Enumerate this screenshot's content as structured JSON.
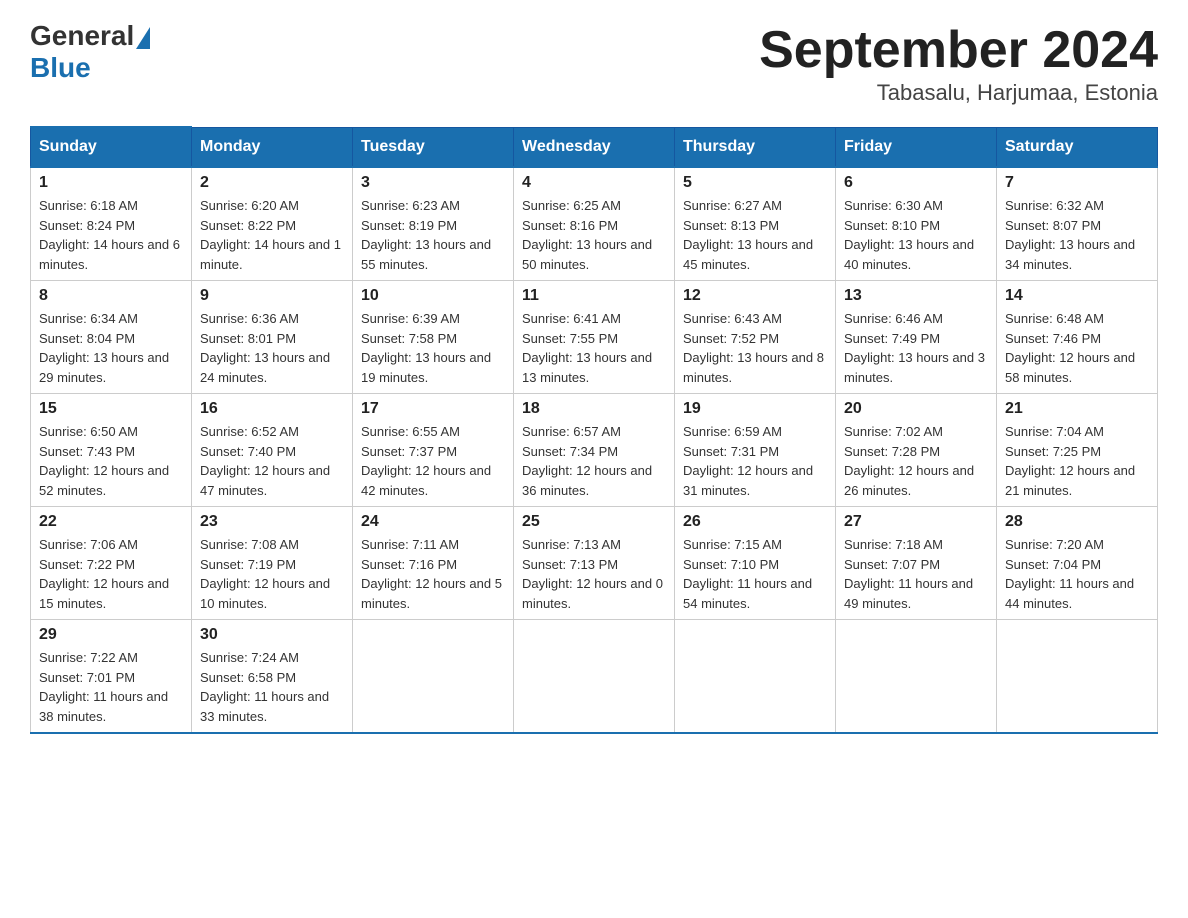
{
  "logo": {
    "general": "General",
    "blue": "Blue"
  },
  "title": "September 2024",
  "location": "Tabasalu, Harjumaa, Estonia",
  "headers": [
    "Sunday",
    "Monday",
    "Tuesday",
    "Wednesday",
    "Thursday",
    "Friday",
    "Saturday"
  ],
  "weeks": [
    [
      {
        "day": "1",
        "sunrise": "6:18 AM",
        "sunset": "8:24 PM",
        "daylight": "14 hours and 6 minutes."
      },
      {
        "day": "2",
        "sunrise": "6:20 AM",
        "sunset": "8:22 PM",
        "daylight": "14 hours and 1 minute."
      },
      {
        "day": "3",
        "sunrise": "6:23 AM",
        "sunset": "8:19 PM",
        "daylight": "13 hours and 55 minutes."
      },
      {
        "day": "4",
        "sunrise": "6:25 AM",
        "sunset": "8:16 PM",
        "daylight": "13 hours and 50 minutes."
      },
      {
        "day": "5",
        "sunrise": "6:27 AM",
        "sunset": "8:13 PM",
        "daylight": "13 hours and 45 minutes."
      },
      {
        "day": "6",
        "sunrise": "6:30 AM",
        "sunset": "8:10 PM",
        "daylight": "13 hours and 40 minutes."
      },
      {
        "day": "7",
        "sunrise": "6:32 AM",
        "sunset": "8:07 PM",
        "daylight": "13 hours and 34 minutes."
      }
    ],
    [
      {
        "day": "8",
        "sunrise": "6:34 AM",
        "sunset": "8:04 PM",
        "daylight": "13 hours and 29 minutes."
      },
      {
        "day": "9",
        "sunrise": "6:36 AM",
        "sunset": "8:01 PM",
        "daylight": "13 hours and 24 minutes."
      },
      {
        "day": "10",
        "sunrise": "6:39 AM",
        "sunset": "7:58 PM",
        "daylight": "13 hours and 19 minutes."
      },
      {
        "day": "11",
        "sunrise": "6:41 AM",
        "sunset": "7:55 PM",
        "daylight": "13 hours and 13 minutes."
      },
      {
        "day": "12",
        "sunrise": "6:43 AM",
        "sunset": "7:52 PM",
        "daylight": "13 hours and 8 minutes."
      },
      {
        "day": "13",
        "sunrise": "6:46 AM",
        "sunset": "7:49 PM",
        "daylight": "13 hours and 3 minutes."
      },
      {
        "day": "14",
        "sunrise": "6:48 AM",
        "sunset": "7:46 PM",
        "daylight": "12 hours and 58 minutes."
      }
    ],
    [
      {
        "day": "15",
        "sunrise": "6:50 AM",
        "sunset": "7:43 PM",
        "daylight": "12 hours and 52 minutes."
      },
      {
        "day": "16",
        "sunrise": "6:52 AM",
        "sunset": "7:40 PM",
        "daylight": "12 hours and 47 minutes."
      },
      {
        "day": "17",
        "sunrise": "6:55 AM",
        "sunset": "7:37 PM",
        "daylight": "12 hours and 42 minutes."
      },
      {
        "day": "18",
        "sunrise": "6:57 AM",
        "sunset": "7:34 PM",
        "daylight": "12 hours and 36 minutes."
      },
      {
        "day": "19",
        "sunrise": "6:59 AM",
        "sunset": "7:31 PM",
        "daylight": "12 hours and 31 minutes."
      },
      {
        "day": "20",
        "sunrise": "7:02 AM",
        "sunset": "7:28 PM",
        "daylight": "12 hours and 26 minutes."
      },
      {
        "day": "21",
        "sunrise": "7:04 AM",
        "sunset": "7:25 PM",
        "daylight": "12 hours and 21 minutes."
      }
    ],
    [
      {
        "day": "22",
        "sunrise": "7:06 AM",
        "sunset": "7:22 PM",
        "daylight": "12 hours and 15 minutes."
      },
      {
        "day": "23",
        "sunrise": "7:08 AM",
        "sunset": "7:19 PM",
        "daylight": "12 hours and 10 minutes."
      },
      {
        "day": "24",
        "sunrise": "7:11 AM",
        "sunset": "7:16 PM",
        "daylight": "12 hours and 5 minutes."
      },
      {
        "day": "25",
        "sunrise": "7:13 AM",
        "sunset": "7:13 PM",
        "daylight": "12 hours and 0 minutes."
      },
      {
        "day": "26",
        "sunrise": "7:15 AM",
        "sunset": "7:10 PM",
        "daylight": "11 hours and 54 minutes."
      },
      {
        "day": "27",
        "sunrise": "7:18 AM",
        "sunset": "7:07 PM",
        "daylight": "11 hours and 49 minutes."
      },
      {
        "day": "28",
        "sunrise": "7:20 AM",
        "sunset": "7:04 PM",
        "daylight": "11 hours and 44 minutes."
      }
    ],
    [
      {
        "day": "29",
        "sunrise": "7:22 AM",
        "sunset": "7:01 PM",
        "daylight": "11 hours and 38 minutes."
      },
      {
        "day": "30",
        "sunrise": "7:24 AM",
        "sunset": "6:58 PM",
        "daylight": "11 hours and 33 minutes."
      },
      null,
      null,
      null,
      null,
      null
    ]
  ]
}
